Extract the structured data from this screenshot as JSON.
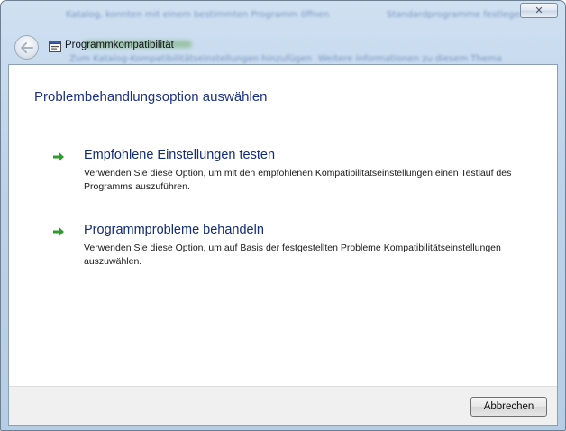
{
  "window": {
    "title": "Programmkompatibilität",
    "close_symbol": "✕",
    "background_blur": {
      "line1_left": "Katalog, konnten mit einem bestimmten Programm öffnen",
      "line1_right": "Standardprogramme festlegen",
      "line2_left": "Zum Katalog-Kompatibilitätseinstellungen hinzufügen",
      "line2_right": "Weitere Informationen zu diesem Thema"
    }
  },
  "icons": {
    "back": "back-arrow-icon",
    "forward": "forward-arrow-icon",
    "program": "program-compatibility-icon",
    "option_arrow": "green-arrow-icon",
    "accent_green": "#2e9c2e",
    "heading_color": "#1e3287"
  },
  "main": {
    "heading": "Problembehandlungsoption auswählen",
    "options": [
      {
        "title": "Empfohlene Einstellungen testen",
        "description": "Verwenden Sie diese Option, um mit den empfohlenen Kompatibilitätseinstellungen einen Testlauf des Programms auszuführen."
      },
      {
        "title": "Programmprobleme behandeln",
        "description": "Verwenden Sie diese Option, um auf Basis der festgestellten Probleme Kompatibilitätseinstellungen auszuwählen."
      }
    ]
  },
  "footer": {
    "cancel_label": "Abbrechen"
  }
}
